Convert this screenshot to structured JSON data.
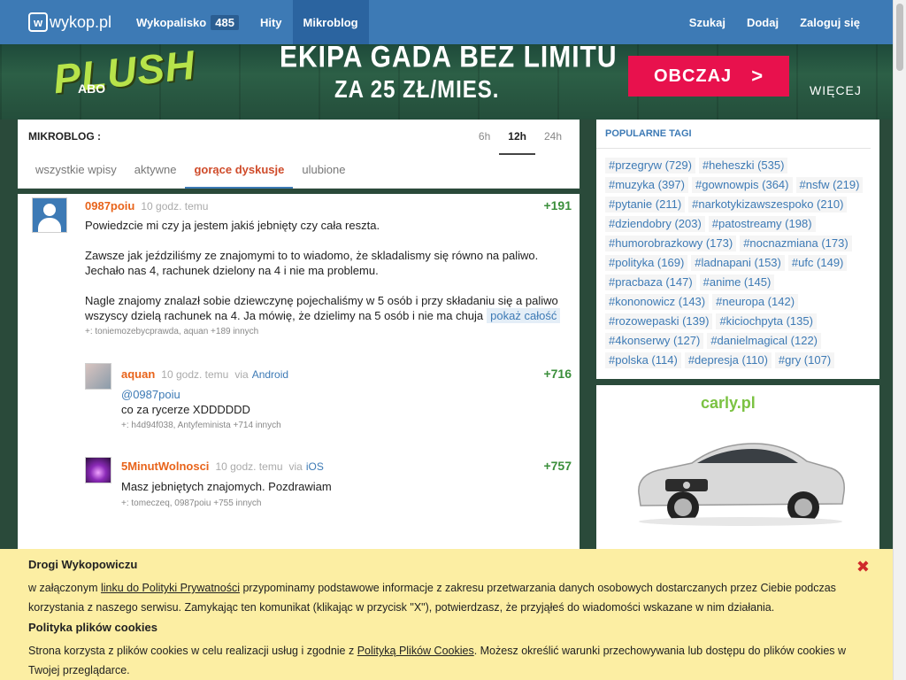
{
  "nav": {
    "logo_text": "wykop.pl",
    "wykopalisko": "Wykopalisko",
    "wykopalisko_count": "485",
    "hity": "Hity",
    "mikroblog": "Mikroblog",
    "szukaj": "Szukaj",
    "dodaj": "Dodaj",
    "zaloguj": "Zaloguj się"
  },
  "banner": {
    "brand": "PLUSH",
    "brand_sub": "ABO",
    "line1": "EKIPA GADA BEZ LIMITU",
    "line2": "ZA 25 ZŁ/MIES.",
    "cta": "OBCZAJ",
    "cta_arrow": ">",
    "more": "WIĘCEJ"
  },
  "mikroblog": {
    "title": "MIKROBLOG :",
    "time_tabs": [
      "6h",
      "12h",
      "24h"
    ],
    "sub_tabs": [
      "wszystkie wpisy",
      "aktywne",
      "gorące dyskusje",
      "ulubione"
    ]
  },
  "entries": {
    "main": {
      "author": "0987poiu",
      "time": "10 godz. temu",
      "votes": "+191",
      "p1": "Powiedzcie mi czy ja jestem jakiś jebnięty czy cała reszta.",
      "p2": "Zawsze jak jeździliśmy ze znajomymi to to wiadomo, że skladalismy się równo na paliwo. Jechało nas 4, rachunek dzielony na 4 i nie ma problemu.",
      "p3": "Nagle znajomy znalazł sobie dziewczynę pojechaliśmy w 5 osób i przy składaniu się a paliwo wszyscy dzielą rachunek na 4. Ja mówię, że dzielimy na 5 osób i nie ma chuja",
      "show_more": "pokaż całość",
      "plus": "+: toniemozebycprawda, aquan +189 innych"
    },
    "reply1": {
      "author": "aquan",
      "time": "10 godz. temu",
      "via": "via",
      "via_link": "Android",
      "votes": "+716",
      "mention": "@0987poiu",
      "text": "co za rycerze XDDDDDD",
      "plus": "+: h4d94f038, Antyfeminista +714 innych"
    },
    "reply2": {
      "author": "5MinutWolnosci",
      "time": "10 godz. temu",
      "via": "via",
      "via_link": "iOS",
      "votes": "+757",
      "text": "Masz jebniętych znajomych. Pozdrawiam",
      "plus": "+: tomeczeq, 0987poiu +755 innych"
    }
  },
  "tags": {
    "title": "POPULARNE TAGI",
    "items": [
      "#przegryw (729)",
      "#heheszki (535)",
      "#muzyka (397)",
      "#gownowpis (364)",
      "#nsfw (219)",
      "#pytanie (211)",
      "#narkotykizawszespoko (210)",
      "#dziendobry (203)",
      "#patostreamy (198)",
      "#humorobrazkowy (173)",
      "#nocnazmiana (173)",
      "#polityka (169)",
      "#ladnapani (153)",
      "#ufc (149)",
      "#pracbaza (147)",
      "#anime (145)",
      "#kononowicz (143)",
      "#neuropa (142)",
      "#rozowepaski (139)",
      "#kiciochpyta (135)",
      "#4konserwy (127)",
      "#danielmagical (122)",
      "#polska (114)",
      "#depresja (110)",
      "#gry (107)"
    ]
  },
  "ad": {
    "brand": "carly.pl"
  },
  "cookie": {
    "title1": "Drogi Wykopowiczu",
    "p1_a": "w załączonym ",
    "p1_link": "linku do Polityki Prywatności",
    "p1_b": " przypominamy podstawowe informacje z zakresu przetwarzania danych osobowych dostarczanych przez Ciebie podczas korzystania z naszego serwisu. Zamykając ten komunikat (klikając w przycisk \"X\"), potwierdzasz, że przyjąłeś do wiadomości wskazane w nim działania.",
    "title2": "Polityka plików cookies",
    "p2_a": "Strona korzysta z plików cookies w celu realizacji usług i zgodnie z ",
    "p2_link": "Polityką Plików Cookies",
    "p2_b": ". Możesz określić warunki przechowywania lub dostępu do plików cookies w Twojej przeglądarce.",
    "close": "✖"
  }
}
